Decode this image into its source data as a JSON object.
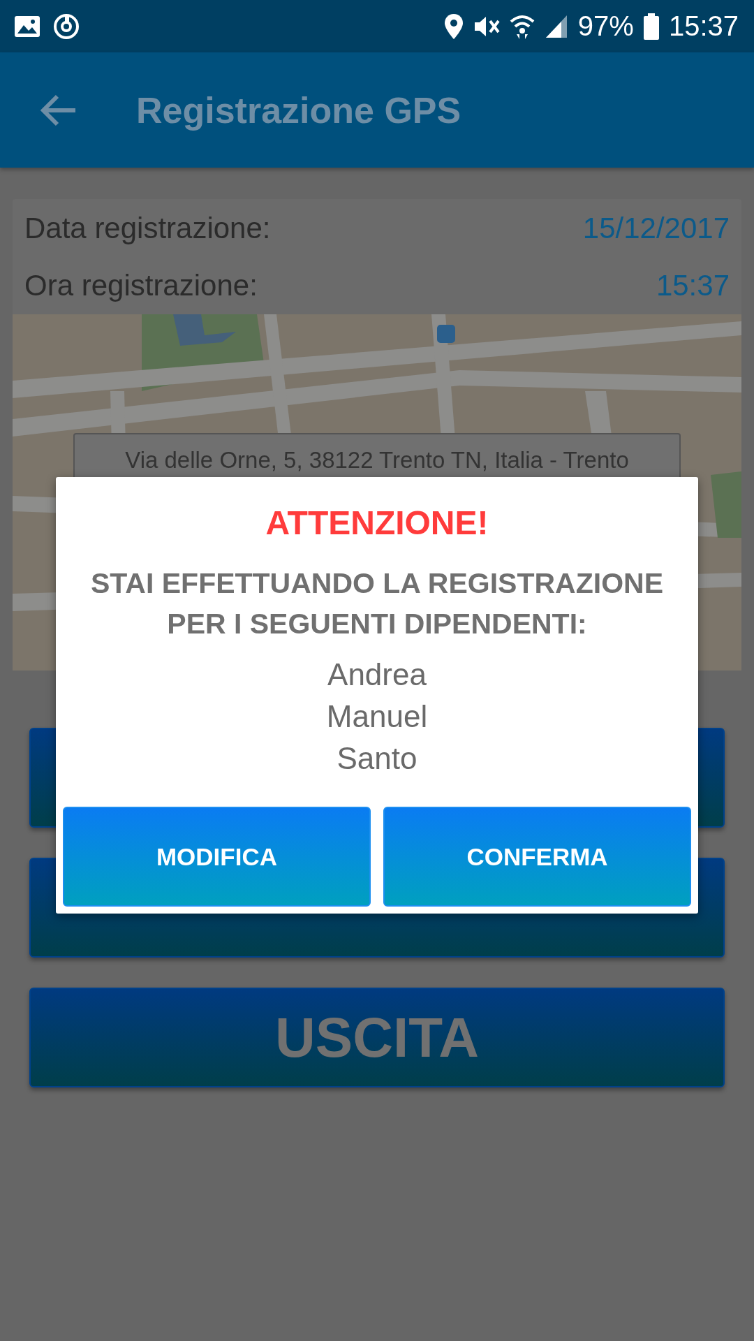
{
  "status_bar": {
    "battery": "97%",
    "time": "15:37"
  },
  "app_bar": {
    "title": "Registrazione GPS"
  },
  "registration": [
    {
      "label": "Data registrazione:",
      "value": "15/12/2017"
    },
    {
      "label": "Ora registrazione:",
      "value": "15:37"
    }
  ],
  "map": {
    "kind": "picture",
    "address": "Via delle Orne, 5, 38122 Trento TN, Italia - Trento"
  },
  "actions": [
    {
      "kind": "covered"
    },
    {
      "kind": "covered"
    },
    {
      "kind": "text",
      "label": "USCITA"
    }
  ],
  "dialog": {
    "title": "ATTENZIONE!",
    "message": "STAI EFFETTUANDO LA REGISTRAZIONE PER I SEGUENTI DIPENDENTI:",
    "names": [
      "Andrea",
      "Manuel",
      "Santo"
    ],
    "buttons": [
      "MODIFICA",
      "CONFERMA"
    ]
  }
}
